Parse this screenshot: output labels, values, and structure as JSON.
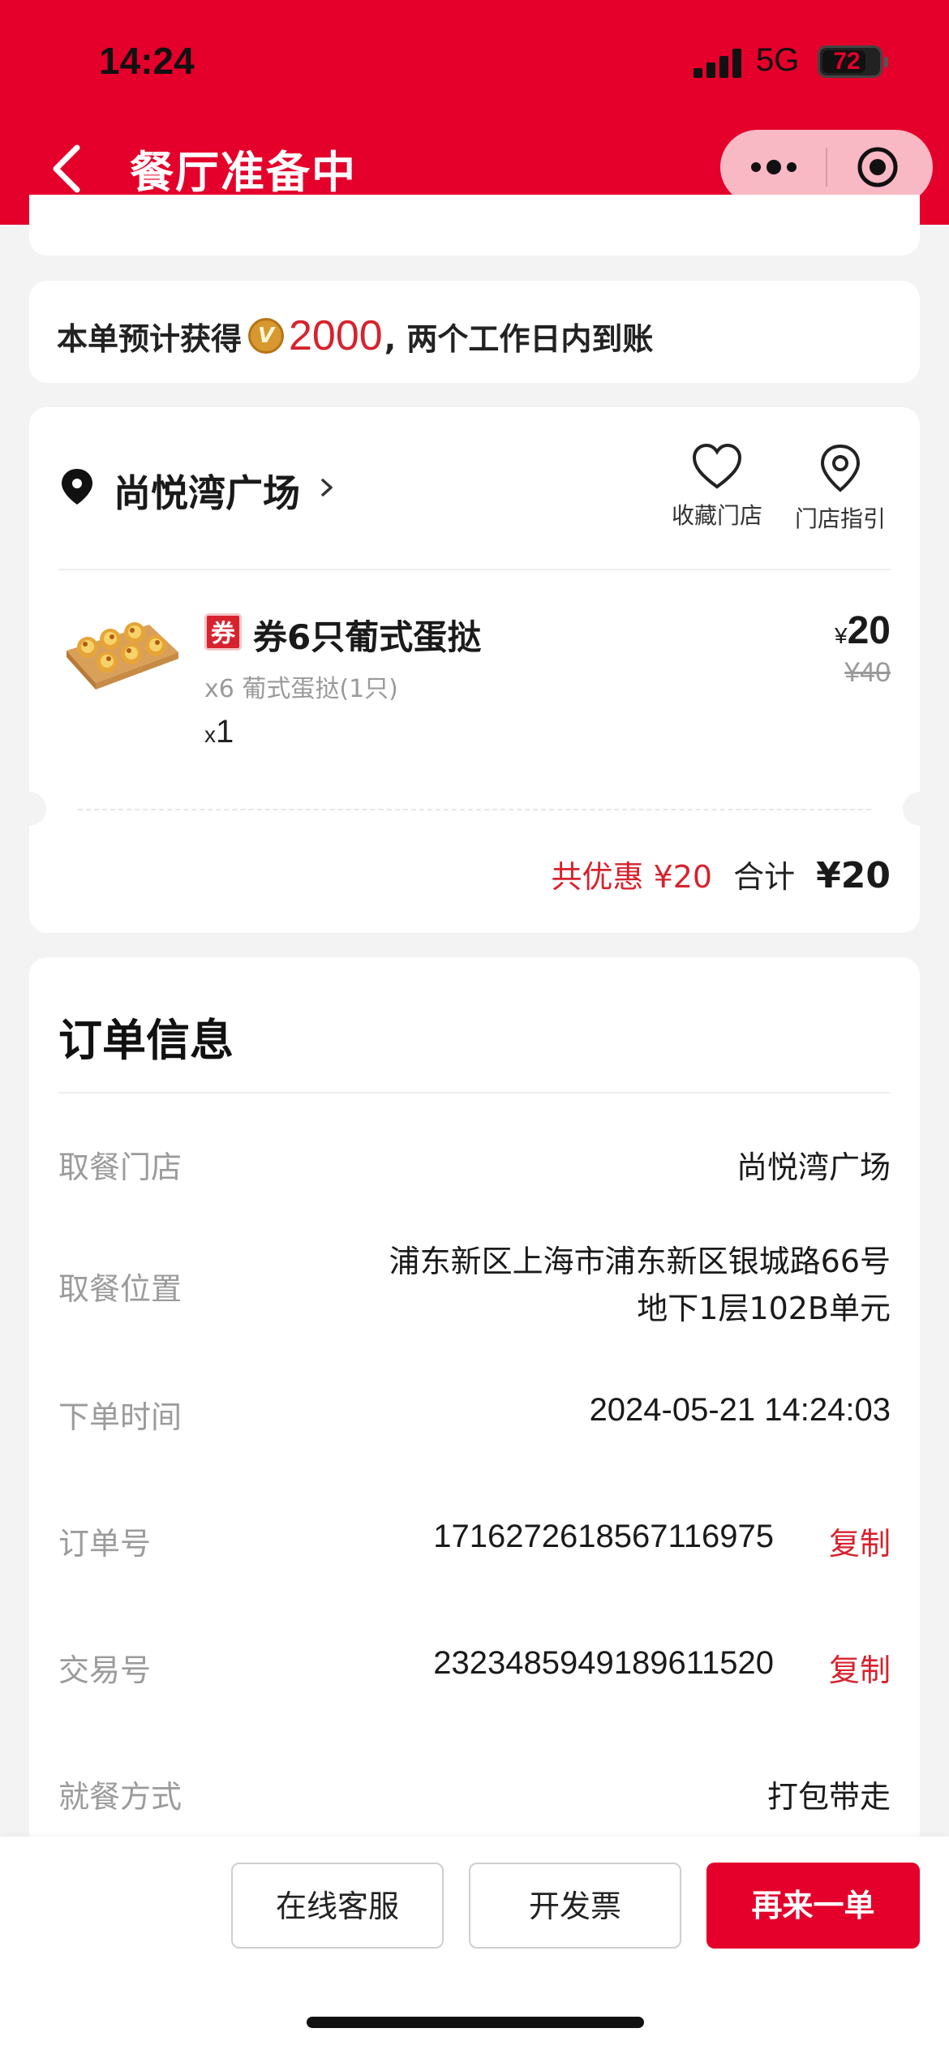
{
  "status_bar": {
    "time": "14:24",
    "network": "5G",
    "battery": "72",
    "battery_level": 0.72
  },
  "header": {
    "title": "餐厅准备中",
    "back_icon": "chevron-left-icon",
    "more_icon": "more-dots-icon",
    "close_icon": "target-circle-icon"
  },
  "points": {
    "prefix": "本单预计获得",
    "coin_letter": "V",
    "amount": "2000",
    "suffix": ", 两个工作日内到账"
  },
  "store": {
    "name": "尚悦湾广场",
    "actions": [
      {
        "label": "收藏门店",
        "icon": "heart-icon"
      },
      {
        "label": "门店指引",
        "icon": "location-pin-icon"
      }
    ]
  },
  "product": {
    "tag": "券",
    "name": "券6只葡式蛋挞",
    "desc": "x6 葡式蛋挞(1只)",
    "qty_prefix": "x",
    "qty": "1",
    "currency": "¥",
    "price": "20",
    "original_price": "¥40"
  },
  "totals": {
    "discount": "共优惠 ¥20",
    "sum_label": "合计",
    "sum_value": "¥20"
  },
  "order": {
    "title": "订单信息",
    "pickup_store_label": "取餐门店",
    "pickup_store_value": "尚悦湾广场",
    "pickup_location_label": "取餐位置",
    "pickup_location_line1": "浦东新区上海市浦东新区银城路66号",
    "pickup_location_line2": "地下1层102B单元",
    "order_time_label": "下单时间",
    "order_time_value": "2024-05-21 14:24:03",
    "order_no_label": "订单号",
    "order_no_value": "1716272618567116975",
    "trade_no_label": "交易号",
    "trade_no_value": "2323485949189611520",
    "copy_label": "复制",
    "dining_label": "就餐方式",
    "dining_value": "打包带走"
  },
  "bottom": {
    "customer_service": "在线客服",
    "invoice": "开发票",
    "reorder": "再来一单"
  },
  "colors": {
    "brand_red": "#e4002b",
    "accent_red": "#d6232e",
    "coin": "#d89830"
  }
}
